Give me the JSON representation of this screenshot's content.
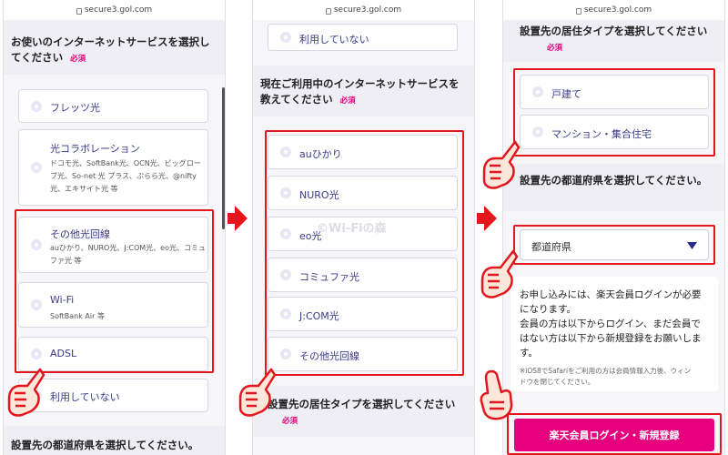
{
  "url": "secure3.gol.com",
  "panel1": {
    "title_lines": [
      "お使いのインターネットサービスを選択し",
      "てください"
    ],
    "required": "必須",
    "options": [
      {
        "label": "フレッツ光",
        "sub": []
      },
      {
        "label": "光コラボレーション",
        "sub": [
          "ドコモ光、SoftBank光、OCN光、ビッグロー",
          "ブ光、So-net 光 プラス、ぷらら光、@nifty",
          "光、エキサイト光 等"
        ]
      },
      {
        "label": "その他光回線",
        "sub": [
          "auひかり、NURO光、J:COM光、eo光、コミュ",
          "ファ光 等"
        ]
      },
      {
        "label": "Wi-Fi",
        "sub": [
          "SoftBank Air 等"
        ]
      },
      {
        "label": "ADSL",
        "sub": []
      },
      {
        "label": "利用していない",
        "sub": []
      }
    ],
    "bottom_title": "設置先の都道府県を選択してください。"
  },
  "panel2": {
    "top_option": "利用していない",
    "title_lines": [
      "現在ご利用中のインターネットサービスを",
      "教えてください"
    ],
    "required": "必須",
    "options": [
      "auひかり",
      "NURO光",
      "eo光",
      "コミュファ光",
      "J:COM光",
      "その他光回線"
    ],
    "bottom_title": "設置先の居住タイプを選択してください",
    "bottom_required": "必須",
    "watermark": "©Wi-Fiの森"
  },
  "panel3": {
    "title1": "設置先の居住タイプを選択してください",
    "required": "必須",
    "options": [
      "戸建て",
      "マンション・集合住宅"
    ],
    "title2": "設置先の都道府県を選択してください。",
    "select_value": "都道府県",
    "notice_lines": [
      "お申し込みには、楽天会員ログインが必要",
      "になります。",
      "会員の方は以下からログイン、まだ会員で",
      "はない方は以下から新規登録をお願いしま",
      "す。"
    ],
    "note_lines": [
      "※iOS8でSafariをご利用の方は会員情報入力後、ウィン",
      "ドウを閉じてください。"
    ],
    "cta_label": "楽天会員ログイン・新規登録"
  },
  "colors": {
    "accent": "#e6007e",
    "highlight": "#e2161c",
    "option_text": "#3a3a8c"
  }
}
